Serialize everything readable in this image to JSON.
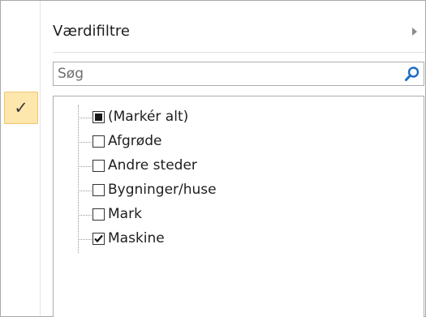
{
  "menu": {
    "submenu_label": "Værdifiltre",
    "selected_marker": "✓"
  },
  "search": {
    "placeholder": "Søg",
    "value": ""
  },
  "filter_list": {
    "items": [
      {
        "label": "(Markér alt)",
        "state": "partial"
      },
      {
        "label": "Afgrøde",
        "state": "unchecked"
      },
      {
        "label": "Andre steder",
        "state": "unchecked"
      },
      {
        "label": "Bygninger/huse",
        "state": "unchecked"
      },
      {
        "label": "Mark",
        "state": "unchecked"
      },
      {
        "label": "Maskine",
        "state": "checked"
      }
    ]
  },
  "icons": {
    "search": "search-icon",
    "submenu_arrow": "chevron-right-icon",
    "check": "check-icon"
  },
  "colors": {
    "highlight_fill": "#fde7ad",
    "highlight_border": "#f2c36b",
    "search_icon": "#1c6dc4"
  }
}
